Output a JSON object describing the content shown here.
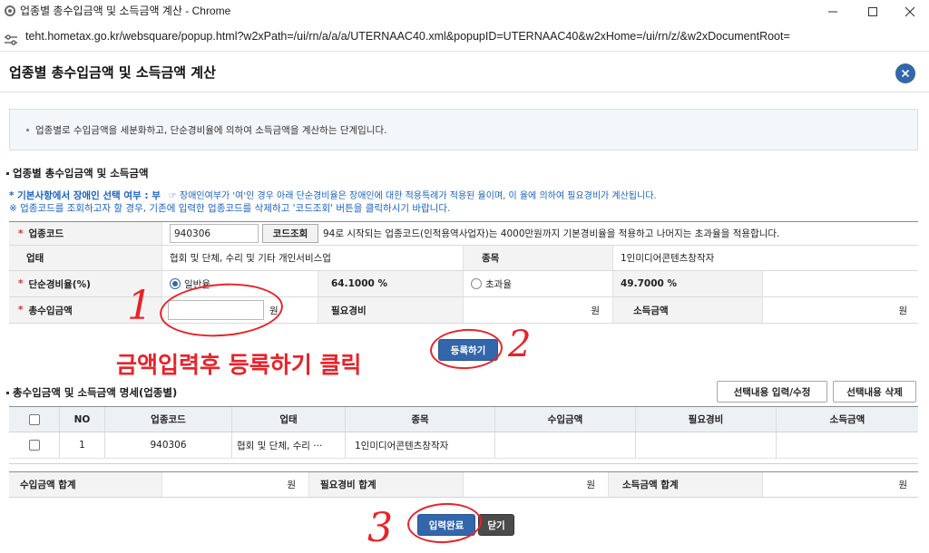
{
  "window": {
    "title": "업종별 총수입금액 및 소득금액 계산 - Chrome",
    "url": "teht.hometax.go.kr/websquare/popup.html?w2xPath=/ui/rn/a/a/a/UTERNAAC40.xml&popupID=UTERNAAC40&w2xHome=/ui/rn/z/&w2xDocumentRoot=",
    "icons": {
      "app": "chrome-app-icon",
      "site": "site-settings-icon",
      "minimize": "minimize-icon",
      "maximize": "maximize-icon",
      "close": "close-icon"
    }
  },
  "page": {
    "title": "업종별 총수입금액 및 소득금액 계산",
    "close_icon": "close-circle-icon",
    "info": "업종별로 수입금액을 세분화하고, 단순경비율에 의하여 소득금액을 계산하는 단계입니다."
  },
  "form": {
    "heading": "업종별 총수입금액 및 소득금액",
    "notice_disabled_status": "* 기본사항에서 장애인 선택 여부 : 부",
    "notice_disabled_detail": "☞ 장애인여부가 '여'인 경우 아래 단순경비율은 장애인에 대한 적용특례가 적용된 율이며, 이 율에 의하여 필요경비가 계산됩니다.",
    "notice_code": "※ 업종코드를 조회하고자 할 경우, 기존에 입력한 업종코드를 삭제하고 '코드조회' 버튼을 클릭하시기 바랍니다.",
    "required_mark": "*",
    "unit": "원",
    "code": {
      "label": "업종코드",
      "value": "940306",
      "lookup_button": "코드조회",
      "note": "94로 시작되는 업종코드(인적용역사업자)는 4000만원까지 기본경비율을 적용하고 나머지는 초과율을 적용합니다."
    },
    "business_type": {
      "label": "업태",
      "value": "협회 및 단체, 수리 및 기타 개인서비스업"
    },
    "item": {
      "label": "종목",
      "value": "1인미디어콘텐츠창작자"
    },
    "rate": {
      "label": "단순경비율(%)",
      "general_label": "일반율",
      "general_value": "64.1000 %",
      "general_selected": true,
      "excess_label": "초과율",
      "excess_value": "49.7000 %",
      "excess_selected": false
    },
    "revenue": {
      "label": "총수입금액",
      "value": ""
    },
    "expense": {
      "label": "필요경비"
    },
    "income": {
      "label": "소득금액"
    },
    "register_button": "등록하기"
  },
  "annotation": {
    "instruction": "금액입력후 등록하기 클릭",
    "step_1": "1",
    "step_2": "2",
    "step_3": "3"
  },
  "detail": {
    "heading": "총수입금액 및 소득금액 명세(업종별)",
    "edit_button": "선택내용 입력/수정",
    "delete_button": "선택내용 삭제",
    "header_checked": false,
    "columns": [
      "NO",
      "업종코드",
      "업태",
      "종목",
      "수입금액",
      "필요경비",
      "소득금액"
    ],
    "rows": [
      {
        "checked": false,
        "no": "1",
        "code": "940306",
        "business_type": "협회 및 단체, 수리 ···",
        "item": "1인미디어콘텐츠창작자"
      }
    ]
  },
  "totals": {
    "revenue_label": "수입금액 합계",
    "expense_label": "필요경비 합계",
    "income_label": "소득금액 합계"
  },
  "footer": {
    "complete_button": "입력완료",
    "close_button": "닫기"
  },
  "colors": {
    "accent": "#3466ab",
    "close_button": "#4b4b4b",
    "notice": "#1a62c0",
    "required": "#d9302b",
    "annotation": "#e8232a"
  }
}
